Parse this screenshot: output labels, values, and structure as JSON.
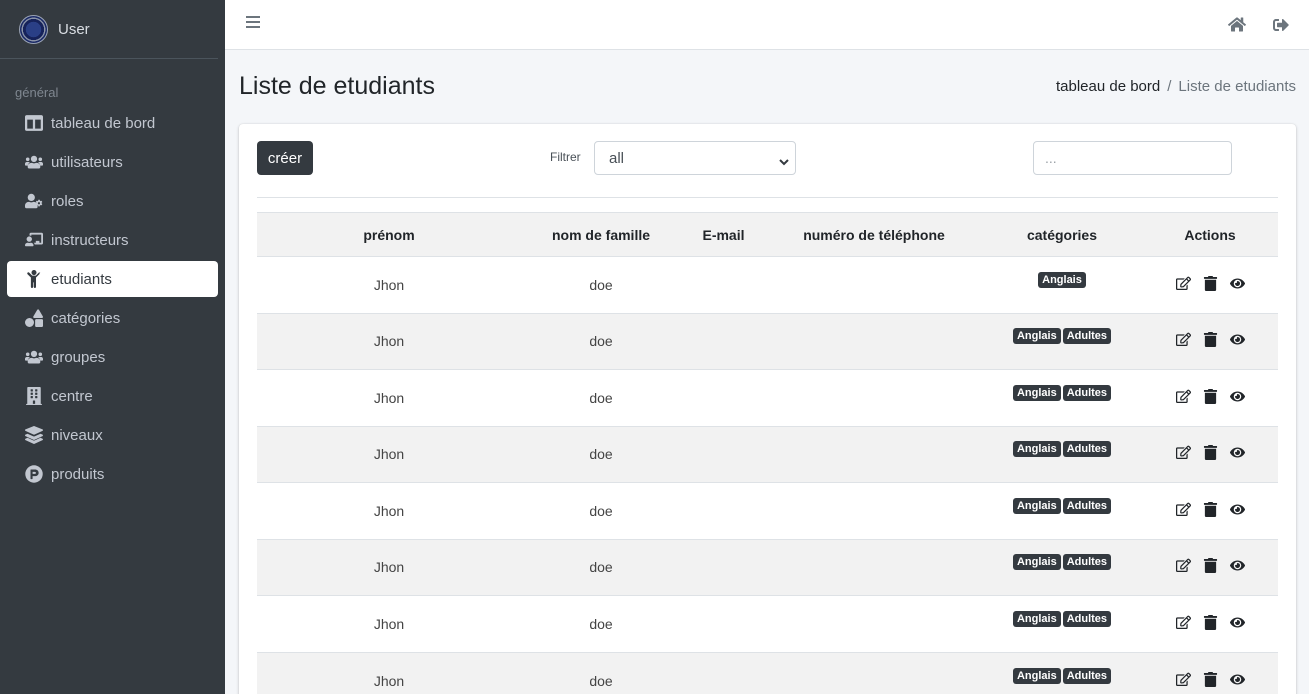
{
  "sidebar": {
    "brand_name": "User",
    "section_label": "général",
    "items": [
      {
        "label": "tableau de bord",
        "icon": "columns-icon",
        "active": false
      },
      {
        "label": "utilisateurs",
        "icon": "users-icon",
        "active": false
      },
      {
        "label": "roles",
        "icon": "user-cog-icon",
        "active": false
      },
      {
        "label": "instructeurs",
        "icon": "chalkboard-teacher-icon",
        "active": false
      },
      {
        "label": "etudiants",
        "icon": "child-icon",
        "active": true
      },
      {
        "label": "catégories",
        "icon": "shapes-icon",
        "active": false
      },
      {
        "label": "groupes",
        "icon": "users-icon",
        "active": false
      },
      {
        "label": "centre",
        "icon": "building-icon",
        "active": false
      },
      {
        "label": "niveaux",
        "icon": "layer-group-icon",
        "active": false
      },
      {
        "label": "produits",
        "icon": "product-p-icon",
        "active": false
      }
    ]
  },
  "header": {
    "title": "Liste de etudiants",
    "breadcrumb": [
      "tableau de bord",
      "Liste de etudiants"
    ],
    "breadcrumb_separator": "/"
  },
  "toolbar": {
    "create_label": "créer",
    "filter_label": "Filtrer",
    "filter_value": "all",
    "search_placeholder": "..."
  },
  "table": {
    "columns": [
      "prénom",
      "nom de famille",
      "E-mail",
      "numéro de téléphone",
      "catégories",
      "Actions"
    ],
    "rows": [
      {
        "prenom": "Jhon",
        "nom": "doe",
        "email": "",
        "phone": "",
        "categories": [
          "Anglais"
        ]
      },
      {
        "prenom": "Jhon",
        "nom": "doe",
        "email": "",
        "phone": "",
        "categories": [
          "Anglais",
          "Adultes"
        ]
      },
      {
        "prenom": "Jhon",
        "nom": "doe",
        "email": "",
        "phone": "",
        "categories": [
          "Anglais",
          "Adultes"
        ]
      },
      {
        "prenom": "Jhon",
        "nom": "doe",
        "email": "",
        "phone": "",
        "categories": [
          "Anglais",
          "Adultes"
        ]
      },
      {
        "prenom": "Jhon",
        "nom": "doe",
        "email": "",
        "phone": "",
        "categories": [
          "Anglais",
          "Adultes"
        ]
      },
      {
        "prenom": "Jhon",
        "nom": "doe",
        "email": "",
        "phone": "",
        "categories": [
          "Anglais",
          "Adultes"
        ]
      },
      {
        "prenom": "Jhon",
        "nom": "doe",
        "email": "",
        "phone": "",
        "categories": [
          "Anglais",
          "Adultes"
        ]
      },
      {
        "prenom": "Jhon",
        "nom": "doe",
        "email": "",
        "phone": "",
        "categories": [
          "Anglais",
          "Adultes"
        ]
      }
    ]
  },
  "colors": {
    "sidebar_bg": "#343a40",
    "badge_bg": "#343a40",
    "stripe": "#f2f2f2"
  }
}
